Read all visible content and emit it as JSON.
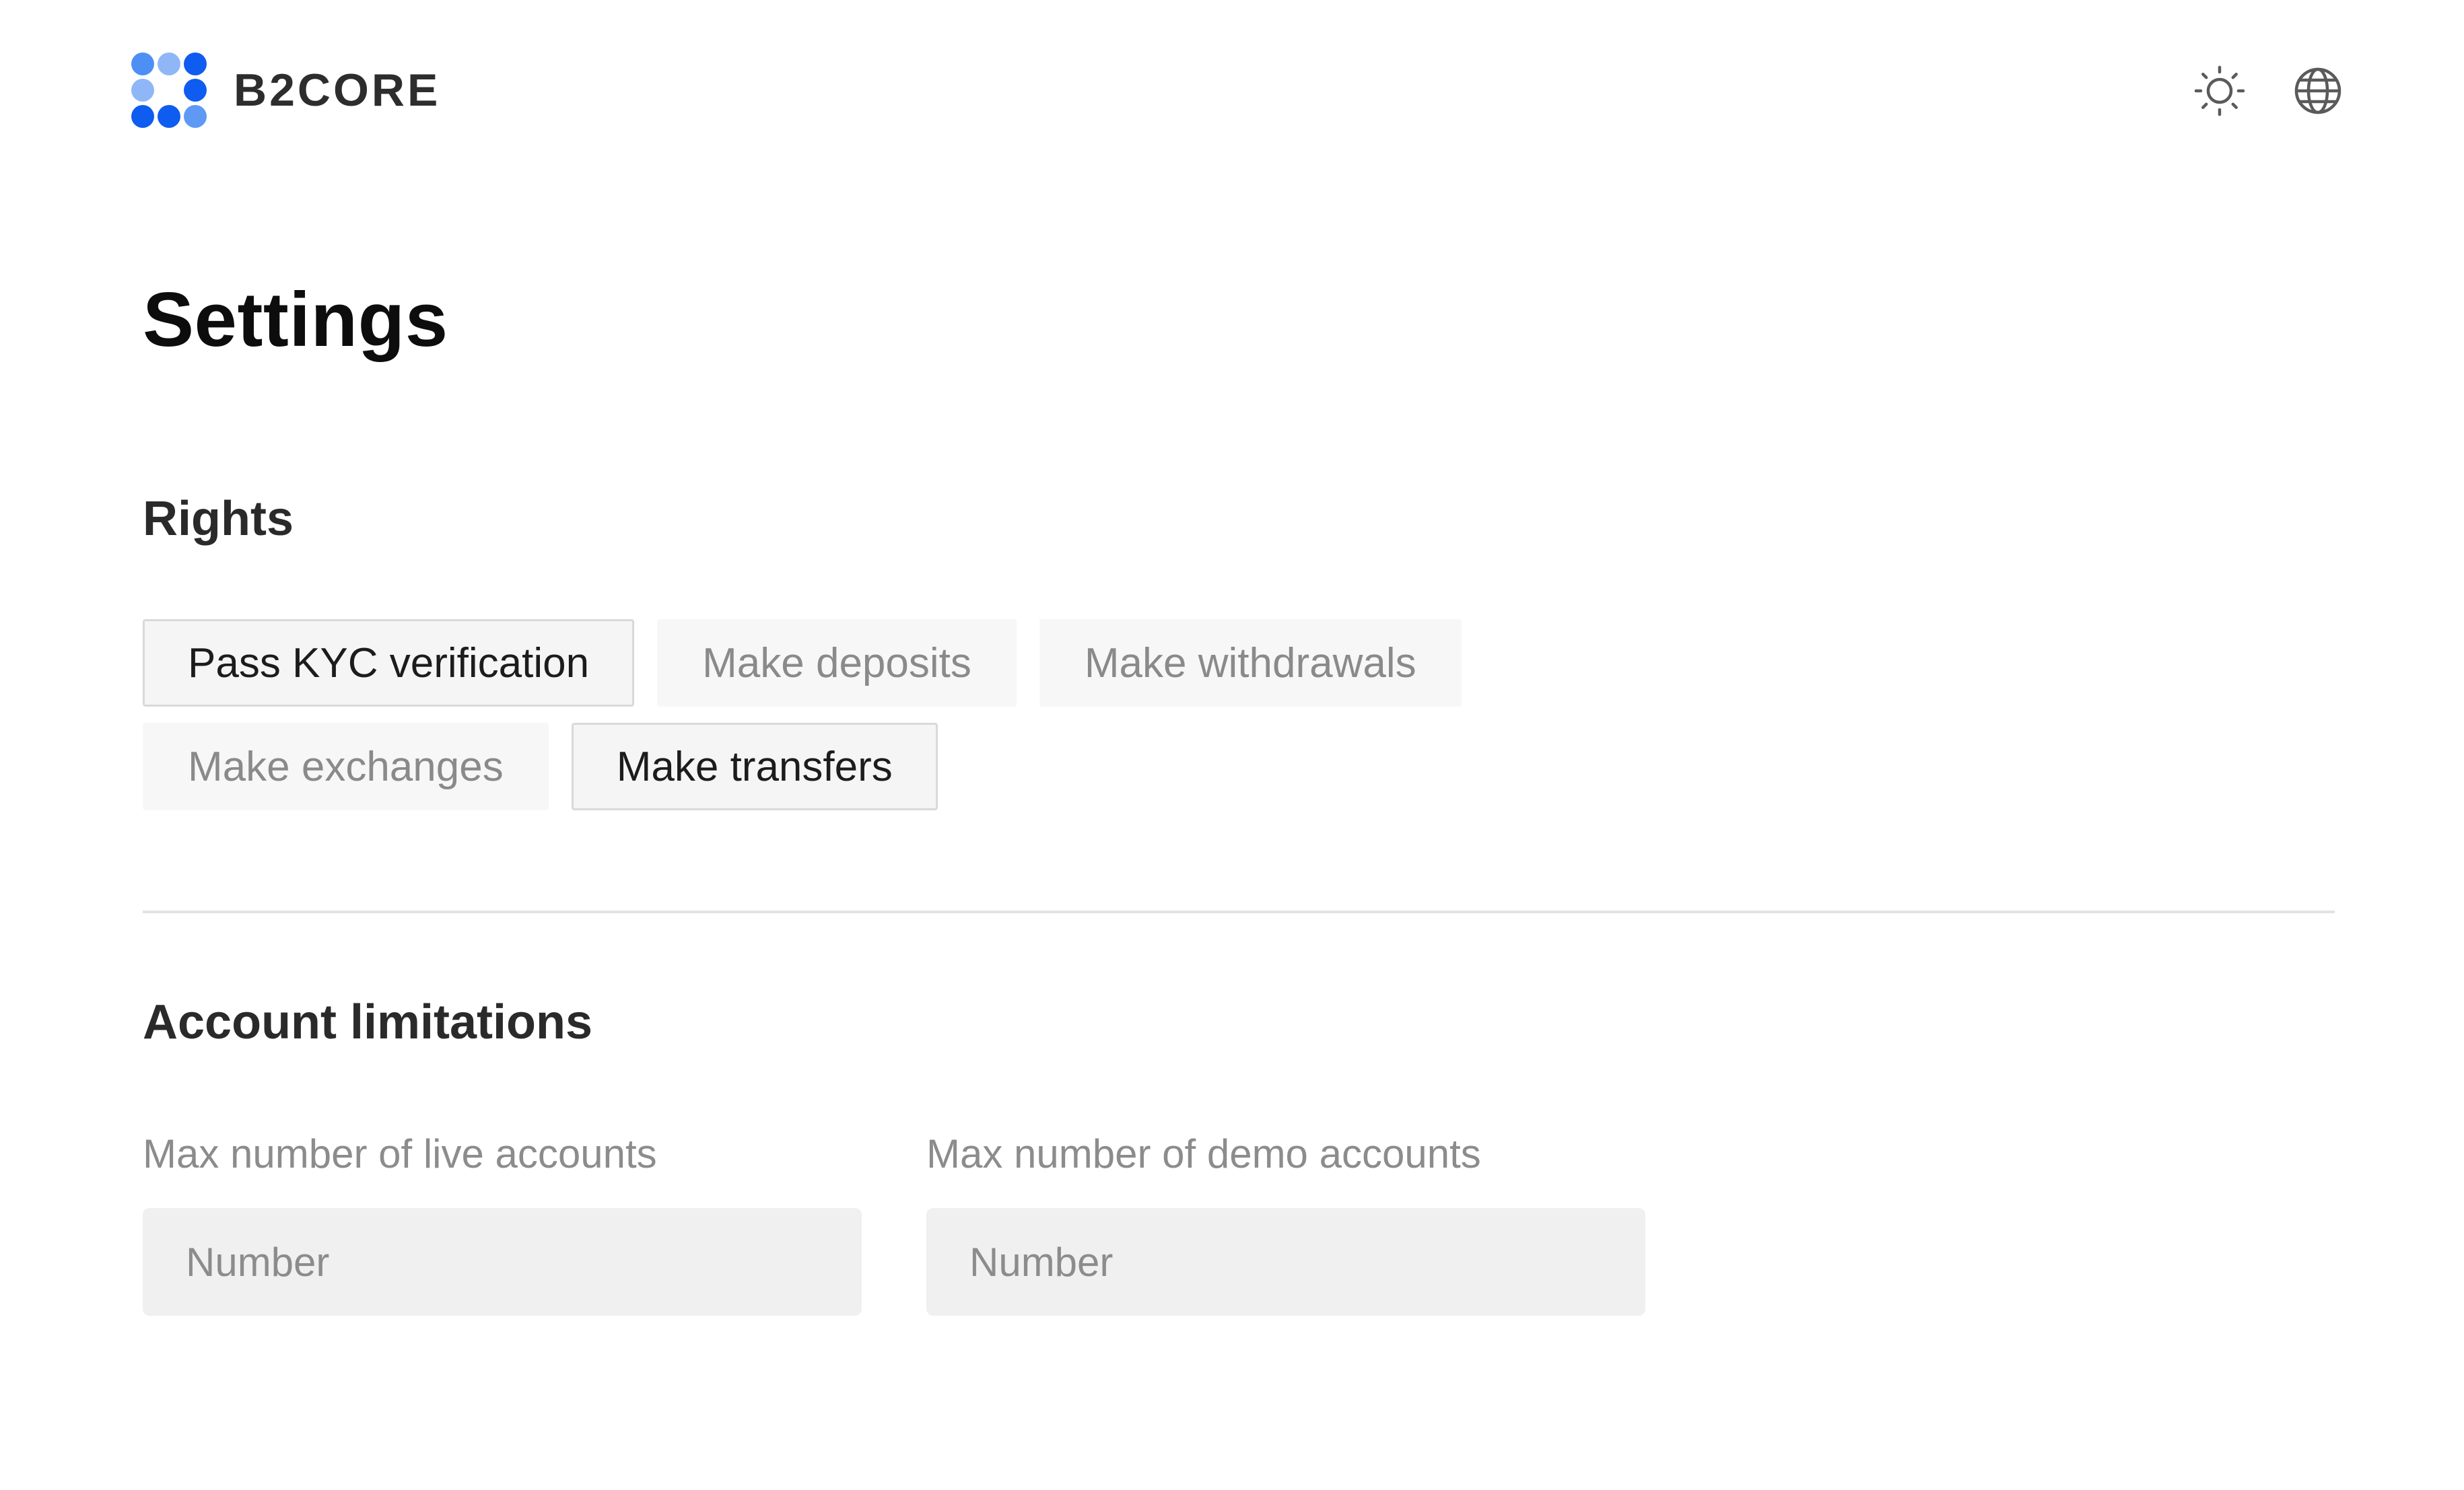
{
  "brand": {
    "name": "B2CORE",
    "colors": {
      "primary": "#0f5cf0",
      "light": "#6ea4f5"
    }
  },
  "header": {
    "theme_icon": "sun-icon",
    "language_icon": "globe-icon"
  },
  "page": {
    "title": "Settings"
  },
  "rights": {
    "title": "Rights",
    "items": [
      {
        "label": "Pass KYC verification",
        "active": true
      },
      {
        "label": "Make deposits",
        "active": false
      },
      {
        "label": "Make withdrawals",
        "active": false
      },
      {
        "label": "Make exchanges",
        "active": false
      },
      {
        "label": "Make transfers",
        "active": true
      }
    ]
  },
  "account_limitations": {
    "title": "Account limitations",
    "live": {
      "label": "Max number of live accounts",
      "placeholder": "Number",
      "value": ""
    },
    "demo": {
      "label": "Max number of demo accounts",
      "placeholder": "Number",
      "value": ""
    }
  }
}
